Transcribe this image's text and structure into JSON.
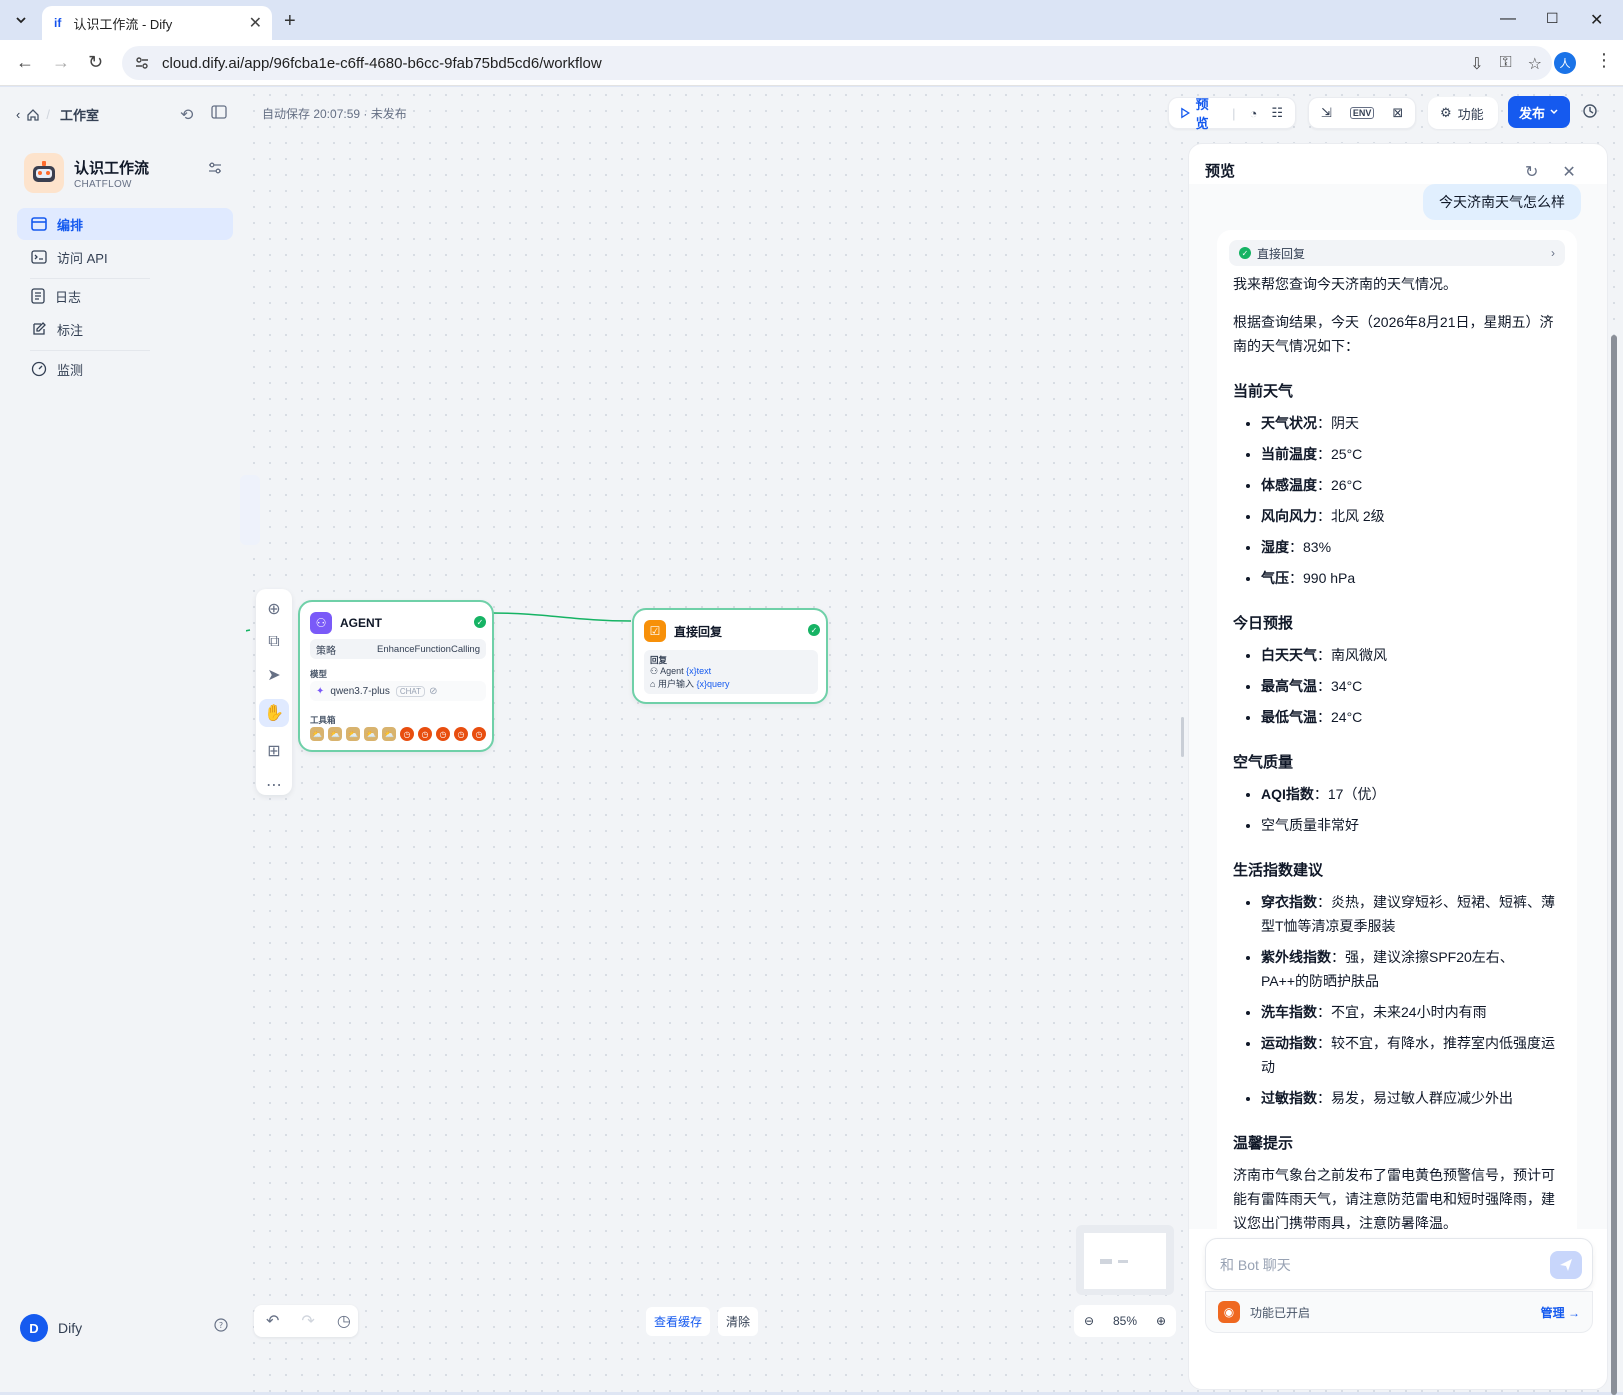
{
  "browser": {
    "tab_title": "认识工作流 - Dify",
    "tab_favicon": "if",
    "url": "cloud.dify.ai/app/96fcba1e-c6ff-4680-b6cc-9fab75bd5cd6/workflow",
    "profile_initial": "人"
  },
  "sidebar": {
    "workspace": "工作室",
    "app_name": "认识工作流",
    "app_type": "CHATFLOW",
    "nav": [
      {
        "label": "编排",
        "icon": "orchestrate-icon",
        "active": true
      },
      {
        "label": "访问 API",
        "icon": "terminal-icon",
        "active": false
      },
      {
        "label": "日志",
        "icon": "log-icon",
        "active": false
      },
      {
        "label": "标注",
        "icon": "annotation-icon",
        "active": false
      },
      {
        "label": "监测",
        "icon": "monitor-icon",
        "active": false
      }
    ],
    "user_initial": "D",
    "user_name": "Dify"
  },
  "canvas": {
    "autosave": "自动保存 20:07:59 · 未发布",
    "toolbar": {
      "preview": "预览",
      "features": "功能",
      "publish": "发布"
    },
    "agent_node": {
      "title": "AGENT",
      "strategy_label": "策略",
      "strategy_value": "EnhanceFunctionCalling",
      "model_label": "模型",
      "model_value": "qwen3.7-plus",
      "model_chip": "CHAT",
      "tools_label": "工具箱"
    },
    "reply_node": {
      "title": "直接回复",
      "reply_label": "回复",
      "line1_node": "Agent",
      "line1_var": "{x}text",
      "line2_node": "用户输入",
      "line2_var": "{x}query"
    },
    "bottom": {
      "view_cache": "查看缓存",
      "clear": "清除",
      "zoom": "85%"
    }
  },
  "preview": {
    "title": "预览",
    "user_question": "今天济南天气怎么样",
    "workflow_step": "直接回复",
    "answer": {
      "intro": "我来帮您查询今天济南的天气情况。",
      "summary": "根据查询结果，今天（2026年8月21日，星期五）济南的天气情况如下：",
      "s1_title": "当前天气",
      "s1": [
        {
          "k": "天气状况",
          "v": "：阴天"
        },
        {
          "k": "当前温度",
          "v": "：25°C"
        },
        {
          "k": "体感温度",
          "v": "：26°C"
        },
        {
          "k": "风向风力",
          "v": "：北风 2级"
        },
        {
          "k": "湿度",
          "v": "：83%"
        },
        {
          "k": "气压",
          "v": "：990 hPa"
        }
      ],
      "s2_title": "今日预报",
      "s2": [
        {
          "k": "白天天气",
          "v": "：南风微风"
        },
        {
          "k": "最高气温",
          "v": "：34°C"
        },
        {
          "k": "最低气温",
          "v": "：24°C"
        }
      ],
      "s3_title": "空气质量",
      "s3_aqi_k": "AQI指数",
      "s3_aqi_v": "：17（优）",
      "s3_note": "空气质量非常好",
      "s4_title": "生活指数建议",
      "s4": [
        {
          "k": "穿衣指数",
          "v": "：炎热，建议穿短衫、短裙、短裤、薄型T恤等清凉夏季服装"
        },
        {
          "k": "紫外线指数",
          "v": "：强，建议涂擦SPF20左右、PA++的防晒护肤品"
        },
        {
          "k": "洗车指数",
          "v": "：不宜，未来24小时内有雨"
        },
        {
          "k": "运动指数",
          "v": "：较不宜，有降水，推荐室内低强度运动"
        },
        {
          "k": "过敏指数",
          "v": "：易发，易过敏人群应减少外出"
        }
      ],
      "s5_title": "温馨提示",
      "s5": "济南市气象台之前发布了雷电黄色预警信号，预计可能有雷阵雨天气，请注意防范雷电和短时强降雨，建议您出门携带雨具，注意防暑降温。"
    },
    "input_placeholder": "和 Bot 聊天",
    "features_enabled": "功能已开启",
    "manage": "管理 →"
  }
}
